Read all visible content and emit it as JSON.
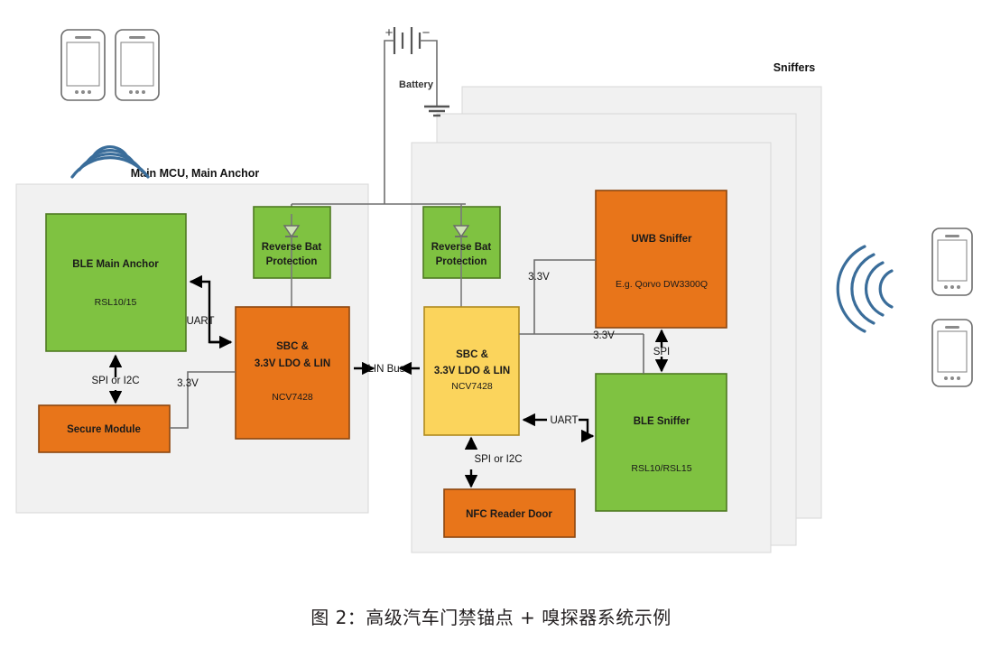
{
  "figure": {
    "caption": "图 2：高级汽车门禁锚点 + 嗅探器系统示例"
  },
  "panels": {
    "mcu": {
      "title": "Main MCU, Main Anchor"
    },
    "sniffers": {
      "title": "Sniffers"
    }
  },
  "power": {
    "battery_label": "Battery",
    "plus_sign": "+",
    "minus_sign": "−"
  },
  "blocks": {
    "ble_main_anchor": {
      "title": "BLE Main Anchor",
      "subtitle": "RSL10/15",
      "color": "#7FC241"
    },
    "secure_module": {
      "title": "Secure Module",
      "subtitle": "",
      "color": "#E8751A"
    },
    "rev_bat_left": {
      "line1": "Reverse Bat",
      "line2": "Protection",
      "color": "#7FC241"
    },
    "rev_bat_right": {
      "line1": "Reverse Bat",
      "line2": "Protection",
      "color": "#7FC241"
    },
    "sbc_left": {
      "line1": "SBC &",
      "line2": "3.3V LDO & LIN",
      "subtitle": "NCV7428",
      "color": "#E8751A"
    },
    "sbc_right": {
      "line1": "SBC &",
      "line2": "3.3V LDO & LIN",
      "subtitle": "NCV7428",
      "color": "#FBD45C"
    },
    "nfc_reader": {
      "title": "NFC Reader Door",
      "subtitle": "",
      "color": "#E8751A"
    },
    "uwb_sniffer": {
      "title": "UWB Sniffer",
      "subtitle": "E.g. Qorvo DW3300Q",
      "color": "#E8751A"
    },
    "ble_sniffer": {
      "title": "BLE Sniffer",
      "subtitle": "RSL10/RSL15",
      "color": "#7FC241"
    }
  },
  "wires": {
    "uart_left": "UART",
    "spi_i2c_left": "SPI or I2C",
    "v33_left": "3.3V",
    "lin_bus": "LIN Bus",
    "v33_upper_right": "3.3V",
    "v33_lower_right": "3.3V",
    "spi_right": "SPI",
    "uart_right": "UART",
    "spi_i2c_right": "SPI or I2C"
  },
  "devices": {
    "phone_top_left": "smartphone",
    "phone_top_left_2": "smartphone",
    "phone_right_top": "smartphone",
    "phone_right_bottom": "smartphone",
    "signal_left": "wireless-signal",
    "signal_right": "wireless-signal"
  },
  "colors": {
    "green": "#7FC241",
    "green_border": "#4F7A22",
    "orange": "#E8751A",
    "orange_border": "#8C4710",
    "yellow": "#FBD45C",
    "yellow_border": "#B08A1E",
    "panel_fill": "#F1F1F1",
    "panel_border": "#D0D0D0",
    "wire": "#6E6E6E",
    "arrow": "#000000",
    "signal_blue": "#31648F"
  }
}
